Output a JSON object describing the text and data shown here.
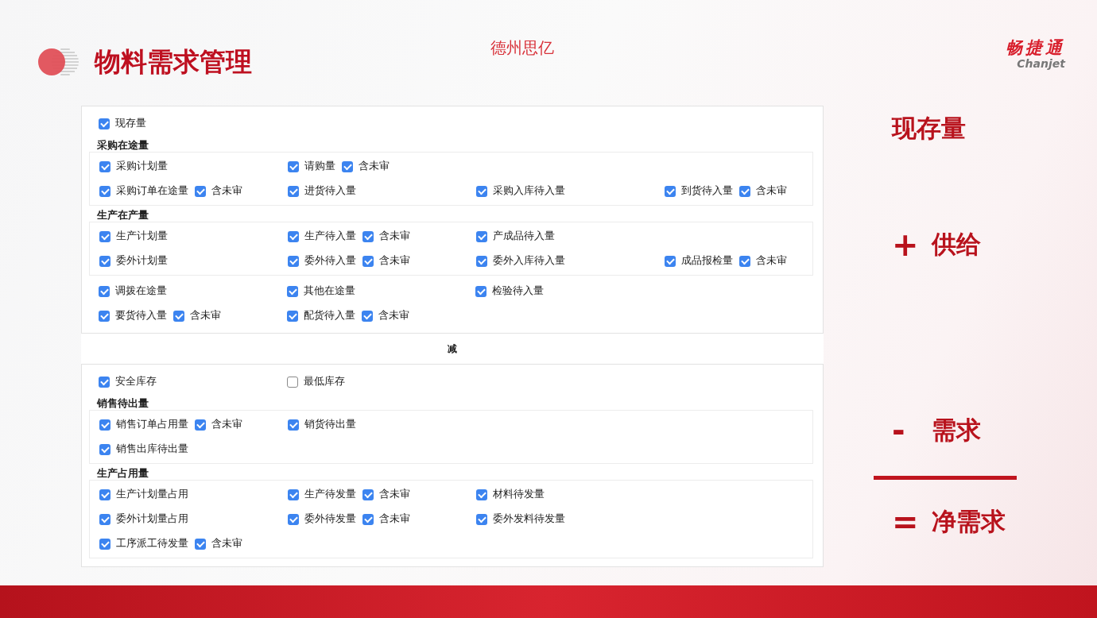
{
  "slide": {
    "title": "物料需求管理",
    "company": "德州思亿",
    "brand": {
      "name": "畅捷通",
      "latin": "Chanjet"
    }
  },
  "form": {
    "supply": [
      {
        "kind": "rows",
        "rows": [
          {
            "cells": [
              [
                {
                  "label": "现存量",
                  "checked": true
                }
              ]
            ]
          }
        ]
      },
      {
        "kind": "group",
        "title": "采购在途量",
        "rows": [
          {
            "cells": [
              [
                {
                  "label": "采购计划量",
                  "checked": true
                }
              ],
              [
                {
                  "label": "请购量",
                  "checked": true
                },
                {
                  "label": "含未审",
                  "checked": true
                }
              ]
            ]
          },
          {
            "cells": [
              [
                {
                  "label": "采购订单在途量",
                  "checked": true
                },
                {
                  "label": "含未审",
                  "checked": true
                }
              ],
              [
                {
                  "label": "进货待入量",
                  "checked": true
                }
              ],
              [
                {
                  "label": "采购入库待入量",
                  "checked": true
                }
              ],
              [
                {
                  "label": "到货待入量",
                  "checked": true
                },
                {
                  "label": "含未审",
                  "checked": true
                }
              ]
            ]
          }
        ]
      },
      {
        "kind": "group",
        "title": "生产在产量",
        "rows": [
          {
            "cells": [
              [
                {
                  "label": "生产计划量",
                  "checked": true
                }
              ],
              [
                {
                  "label": "生产待入量",
                  "checked": true
                },
                {
                  "label": "含未审",
                  "checked": true
                }
              ],
              [
                {
                  "label": "产成品待入量",
                  "checked": true
                }
              ]
            ]
          },
          {
            "cells": [
              [
                {
                  "label": "委外计划量",
                  "checked": true
                }
              ],
              [
                {
                  "label": "委外待入量",
                  "checked": true
                },
                {
                  "label": "含未审",
                  "checked": true
                }
              ],
              [
                {
                  "label": "委外入库待入量",
                  "checked": true
                }
              ],
              [
                {
                  "label": "成品报检量",
                  "checked": true
                },
                {
                  "label": "含未审",
                  "checked": true
                }
              ]
            ]
          }
        ]
      },
      {
        "kind": "rows",
        "rows": [
          {
            "cells": [
              [
                {
                  "label": "调拨在途量",
                  "checked": true
                }
              ],
              [
                {
                  "label": "其他在途量",
                  "checked": true
                }
              ],
              [
                {
                  "label": "检验待入量",
                  "checked": true
                }
              ]
            ]
          },
          {
            "cells": [
              [
                {
                  "label": "要货待入量",
                  "checked": true
                },
                {
                  "label": "含未审",
                  "checked": true
                }
              ],
              [
                {
                  "label": "配货待入量",
                  "checked": true
                },
                {
                  "label": "含未审",
                  "checked": true
                }
              ]
            ]
          }
        ]
      }
    ],
    "divider_label": "减",
    "demand": [
      {
        "kind": "rows",
        "rows": [
          {
            "cells": [
              [
                {
                  "label": "安全库存",
                  "checked": true
                }
              ],
              [
                {
                  "label": "最低库存",
                  "checked": false
                }
              ]
            ]
          }
        ]
      },
      {
        "kind": "group",
        "title": "销售待出量",
        "rows": [
          {
            "cells": [
              [
                {
                  "label": "销售订单占用量",
                  "checked": true
                },
                {
                  "label": "含未审",
                  "checked": true
                }
              ],
              [
                {
                  "label": "销货待出量",
                  "checked": true
                }
              ]
            ]
          },
          {
            "cells": [
              [
                {
                  "label": "销售出库待出量",
                  "checked": true
                }
              ]
            ]
          }
        ]
      },
      {
        "kind": "group",
        "title": "生产占用量",
        "rows": [
          {
            "cells": [
              [
                {
                  "label": "生产计划量占用",
                  "checked": true
                }
              ],
              [
                {
                  "label": "生产待发量",
                  "checked": true
                },
                {
                  "label": "含未审",
                  "checked": true
                }
              ],
              [
                {
                  "label": "材料待发量",
                  "checked": true
                }
              ]
            ]
          },
          {
            "cells": [
              [
                {
                  "label": "委外计划量占用",
                  "checked": true
                }
              ],
              [
                {
                  "label": "委外待发量",
                  "checked": true
                },
                {
                  "label": "含未审",
                  "checked": true
                }
              ],
              [
                {
                  "label": "委外发料待发量",
                  "checked": true
                }
              ]
            ]
          },
          {
            "cells": [
              [
                {
                  "label": "工序派工待发量",
                  "checked": true
                },
                {
                  "label": "含未审",
                  "checked": true
                }
              ]
            ]
          }
        ]
      }
    ]
  },
  "formula": [
    {
      "label": "现存量"
    },
    {
      "symbol": "+",
      "label": "供给"
    },
    {
      "symbol": "-",
      "label": "需求",
      "rule_below": true
    },
    {
      "symbol": "=",
      "label": "净需求"
    }
  ]
}
